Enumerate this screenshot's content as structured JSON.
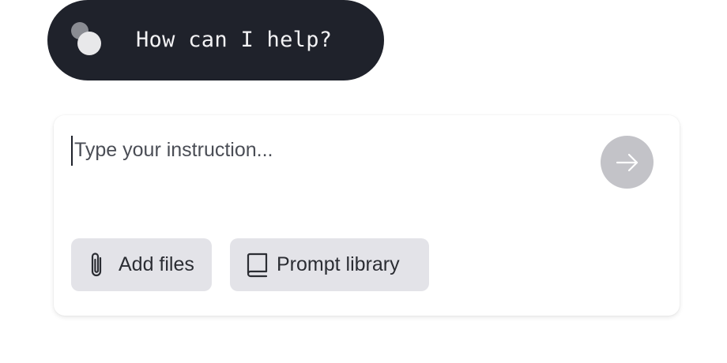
{
  "greeting": {
    "text": "How can I help?",
    "logo_icon": "assistant-logo-icon"
  },
  "composer": {
    "input": {
      "value": "",
      "placeholder": "Type your instruction..."
    },
    "send_button": {
      "icon": "arrow-right-icon",
      "state": "disabled"
    },
    "actions": [
      {
        "label": "Add files",
        "icon": "paperclip-icon"
      },
      {
        "label": "Prompt library",
        "icon": "book-icon"
      }
    ]
  },
  "colors": {
    "greeting_background": "#1f222b",
    "send_button_background": "#c3c3c8",
    "chip_background": "#e3e3e8"
  }
}
